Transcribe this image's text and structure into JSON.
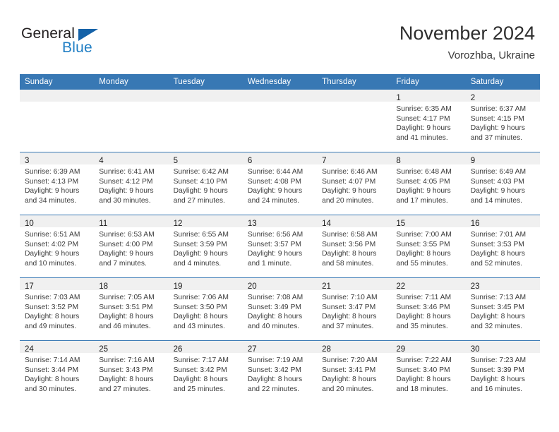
{
  "brand": {
    "word_one": "General",
    "word_two": "Blue",
    "triangle_icon": "triangle-icon",
    "accent_blue": "#1f7ec4",
    "dark_blue": "#1562a8"
  },
  "header": {
    "month_title": "November 2024",
    "location": "Vorozhba, Ukraine"
  },
  "theme": {
    "header_bar": "#3878b4",
    "daynum_strip": "#f0f0f0",
    "row_divider": "#3878b4"
  },
  "weekday_headers": [
    "Sunday",
    "Monday",
    "Tuesday",
    "Wednesday",
    "Thursday",
    "Friday",
    "Saturday"
  ],
  "calendar": {
    "weeks": [
      [
        {
          "day": "",
          "lines": [],
          "empty": true
        },
        {
          "day": "",
          "lines": [],
          "empty": true
        },
        {
          "day": "",
          "lines": [],
          "empty": true
        },
        {
          "day": "",
          "lines": [],
          "empty": true
        },
        {
          "day": "",
          "lines": [],
          "empty": true
        },
        {
          "day": "1",
          "lines": [
            "Sunrise: 6:35 AM",
            "Sunset: 4:17 PM",
            "Daylight: 9 hours",
            "and 41 minutes."
          ],
          "empty": false
        },
        {
          "day": "2",
          "lines": [
            "Sunrise: 6:37 AM",
            "Sunset: 4:15 PM",
            "Daylight: 9 hours",
            "and 37 minutes."
          ],
          "empty": false
        }
      ],
      [
        {
          "day": "3",
          "lines": [
            "Sunrise: 6:39 AM",
            "Sunset: 4:13 PM",
            "Daylight: 9 hours",
            "and 34 minutes."
          ],
          "empty": false
        },
        {
          "day": "4",
          "lines": [
            "Sunrise: 6:41 AM",
            "Sunset: 4:12 PM",
            "Daylight: 9 hours",
            "and 30 minutes."
          ],
          "empty": false
        },
        {
          "day": "5",
          "lines": [
            "Sunrise: 6:42 AM",
            "Sunset: 4:10 PM",
            "Daylight: 9 hours",
            "and 27 minutes."
          ],
          "empty": false
        },
        {
          "day": "6",
          "lines": [
            "Sunrise: 6:44 AM",
            "Sunset: 4:08 PM",
            "Daylight: 9 hours",
            "and 24 minutes."
          ],
          "empty": false
        },
        {
          "day": "7",
          "lines": [
            "Sunrise: 6:46 AM",
            "Sunset: 4:07 PM",
            "Daylight: 9 hours",
            "and 20 minutes."
          ],
          "empty": false
        },
        {
          "day": "8",
          "lines": [
            "Sunrise: 6:48 AM",
            "Sunset: 4:05 PM",
            "Daylight: 9 hours",
            "and 17 minutes."
          ],
          "empty": false
        },
        {
          "day": "9",
          "lines": [
            "Sunrise: 6:49 AM",
            "Sunset: 4:03 PM",
            "Daylight: 9 hours",
            "and 14 minutes."
          ],
          "empty": false
        }
      ],
      [
        {
          "day": "10",
          "lines": [
            "Sunrise: 6:51 AM",
            "Sunset: 4:02 PM",
            "Daylight: 9 hours",
            "and 10 minutes."
          ],
          "empty": false
        },
        {
          "day": "11",
          "lines": [
            "Sunrise: 6:53 AM",
            "Sunset: 4:00 PM",
            "Daylight: 9 hours",
            "and 7 minutes."
          ],
          "empty": false
        },
        {
          "day": "12",
          "lines": [
            "Sunrise: 6:55 AM",
            "Sunset: 3:59 PM",
            "Daylight: 9 hours",
            "and 4 minutes."
          ],
          "empty": false
        },
        {
          "day": "13",
          "lines": [
            "Sunrise: 6:56 AM",
            "Sunset: 3:57 PM",
            "Daylight: 9 hours",
            "and 1 minute."
          ],
          "empty": false
        },
        {
          "day": "14",
          "lines": [
            "Sunrise: 6:58 AM",
            "Sunset: 3:56 PM",
            "Daylight: 8 hours",
            "and 58 minutes."
          ],
          "empty": false
        },
        {
          "day": "15",
          "lines": [
            "Sunrise: 7:00 AM",
            "Sunset: 3:55 PM",
            "Daylight: 8 hours",
            "and 55 minutes."
          ],
          "empty": false
        },
        {
          "day": "16",
          "lines": [
            "Sunrise: 7:01 AM",
            "Sunset: 3:53 PM",
            "Daylight: 8 hours",
            "and 52 minutes."
          ],
          "empty": false
        }
      ],
      [
        {
          "day": "17",
          "lines": [
            "Sunrise: 7:03 AM",
            "Sunset: 3:52 PM",
            "Daylight: 8 hours",
            "and 49 minutes."
          ],
          "empty": false
        },
        {
          "day": "18",
          "lines": [
            "Sunrise: 7:05 AM",
            "Sunset: 3:51 PM",
            "Daylight: 8 hours",
            "and 46 minutes."
          ],
          "empty": false
        },
        {
          "day": "19",
          "lines": [
            "Sunrise: 7:06 AM",
            "Sunset: 3:50 PM",
            "Daylight: 8 hours",
            "and 43 minutes."
          ],
          "empty": false
        },
        {
          "day": "20",
          "lines": [
            "Sunrise: 7:08 AM",
            "Sunset: 3:49 PM",
            "Daylight: 8 hours",
            "and 40 minutes."
          ],
          "empty": false
        },
        {
          "day": "21",
          "lines": [
            "Sunrise: 7:10 AM",
            "Sunset: 3:47 PM",
            "Daylight: 8 hours",
            "and 37 minutes."
          ],
          "empty": false
        },
        {
          "day": "22",
          "lines": [
            "Sunrise: 7:11 AM",
            "Sunset: 3:46 PM",
            "Daylight: 8 hours",
            "and 35 minutes."
          ],
          "empty": false
        },
        {
          "day": "23",
          "lines": [
            "Sunrise: 7:13 AM",
            "Sunset: 3:45 PM",
            "Daylight: 8 hours",
            "and 32 minutes."
          ],
          "empty": false
        }
      ],
      [
        {
          "day": "24",
          "lines": [
            "Sunrise: 7:14 AM",
            "Sunset: 3:44 PM",
            "Daylight: 8 hours",
            "and 30 minutes."
          ],
          "empty": false
        },
        {
          "day": "25",
          "lines": [
            "Sunrise: 7:16 AM",
            "Sunset: 3:43 PM",
            "Daylight: 8 hours",
            "and 27 minutes."
          ],
          "empty": false
        },
        {
          "day": "26",
          "lines": [
            "Sunrise: 7:17 AM",
            "Sunset: 3:42 PM",
            "Daylight: 8 hours",
            "and 25 minutes."
          ],
          "empty": false
        },
        {
          "day": "27",
          "lines": [
            "Sunrise: 7:19 AM",
            "Sunset: 3:42 PM",
            "Daylight: 8 hours",
            "and 22 minutes."
          ],
          "empty": false
        },
        {
          "day": "28",
          "lines": [
            "Sunrise: 7:20 AM",
            "Sunset: 3:41 PM",
            "Daylight: 8 hours",
            "and 20 minutes."
          ],
          "empty": false
        },
        {
          "day": "29",
          "lines": [
            "Sunrise: 7:22 AM",
            "Sunset: 3:40 PM",
            "Daylight: 8 hours",
            "and 18 minutes."
          ],
          "empty": false
        },
        {
          "day": "30",
          "lines": [
            "Sunrise: 7:23 AM",
            "Sunset: 3:39 PM",
            "Daylight: 8 hours",
            "and 16 minutes."
          ],
          "empty": false
        }
      ]
    ]
  }
}
